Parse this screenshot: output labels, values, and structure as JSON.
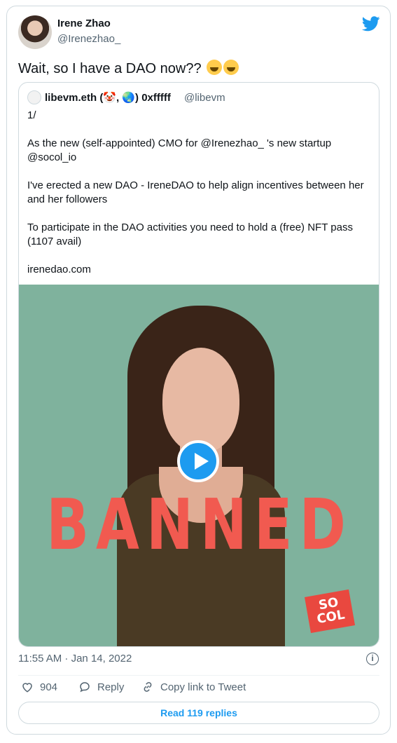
{
  "author": {
    "name": "Irene Zhao",
    "handle": "@Irenezhao_"
  },
  "tweet_text": "Wait, so I have a DAO now??",
  "quoted": {
    "name": "libevm.eth (🤡, 🌏) 0xfffff",
    "handle": "@libevm",
    "body": "1/\n\nAs the new (self-appointed) CMO for @Irenezhao_ 's new startup @socol_io\n\nI've erected a new DAO - IreneDAO to help align incentives between her and her followers\n\nTo participate in the DAO activities you need to hold a (free) NFT pass (1107 avail)\n\nirenedao.com",
    "media_overlay_text": "BANNED",
    "media_logo_text": "SO COL"
  },
  "timestamp": "11:55 AM · Jan 14, 2022",
  "actions": {
    "likes": "904",
    "reply_label": "Reply",
    "copy_link_label": "Copy link to Tweet"
  },
  "read_replies_label": "Read 119 replies",
  "colors": {
    "accent": "#1d9bf0",
    "muted": "#536471",
    "border": "#cfd9de",
    "media_bg": "#7fb29d",
    "banned": "#f15a50"
  }
}
